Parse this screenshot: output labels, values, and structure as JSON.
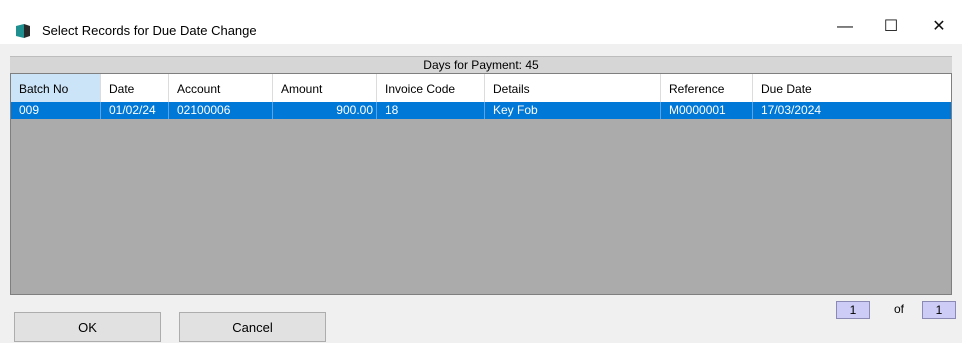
{
  "window": {
    "title": "Select Records for Due Date Change",
    "min_glyph": "—",
    "max_glyph": "☐",
    "close_glyph": "✕"
  },
  "header_strip": {
    "text": "Days for Payment: 45"
  },
  "table": {
    "columns": [
      "Batch No",
      "Date",
      "Account",
      "Amount",
      "Invoice Code",
      "Details",
      "Reference",
      "Due Date"
    ],
    "rows": [
      {
        "batch_no": "009",
        "date": "01/02/24",
        "account": "02100006",
        "amount": "900.00",
        "invoice_code": "18",
        "details": "Key Fob",
        "reference": "M0000001",
        "due_date": "17/03/2024"
      }
    ]
  },
  "pager": {
    "current": "1",
    "of_label": "of",
    "total": "1"
  },
  "buttons": {
    "ok": "OK",
    "cancel": "Cancel"
  },
  "colors": {
    "selection": "#0078d7",
    "grid_bg": "#ababab",
    "pager_bg": "#ccccf7"
  }
}
